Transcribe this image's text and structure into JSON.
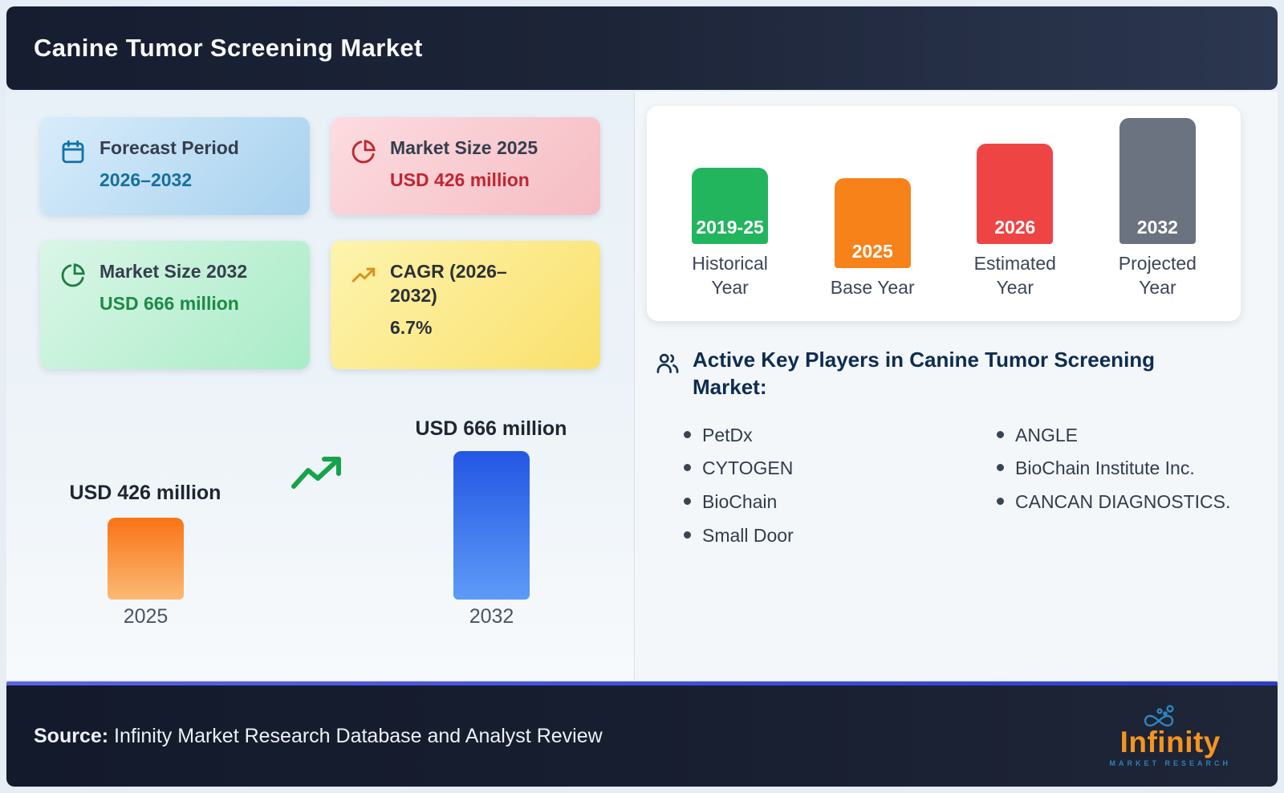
{
  "header": {
    "title": "Canine Tumor Screening Market"
  },
  "cards": [
    {
      "icon": "calendar-icon",
      "title": "Forecast Period",
      "value": "2026–2032"
    },
    {
      "icon": "pie-chart-icon",
      "title": "Market Size 2025",
      "value": "USD 426 million"
    },
    {
      "icon": "pie-chart-icon",
      "title": "Market Size 2032",
      "value": "USD 666 million"
    },
    {
      "icon": "trend-up-icon",
      "title": "CAGR (2026–2032)",
      "value": "6.7%"
    }
  ],
  "chart_data": [
    {
      "type": "bar",
      "title": "Canine Tumor Screening Market size growth",
      "categories": [
        "2025",
        "2032"
      ],
      "values": [
        426,
        666
      ],
      "unit": "USD million",
      "data_labels": [
        "USD 426 million",
        "USD 666 million"
      ],
      "bar_colors": [
        "#f97316",
        "#2563eb"
      ],
      "annotations": [
        "growth-arrow-icon between bars"
      ],
      "grid": false,
      "legend": false
    },
    {
      "type": "bar",
      "title": "Study period timeline",
      "categories": [
        "Historical Year",
        "Base Year",
        "Estimated Year",
        "Projected Year"
      ],
      "bar_labels": [
        "2019-25",
        "2025",
        "2026",
        "2032"
      ],
      "values": [
        1,
        2,
        3,
        4
      ],
      "values_note": "relative heights only, no numeric axis shown",
      "bar_colors": [
        "#22b55e",
        "#f8821a",
        "#ee4444",
        "#6b7280"
      ],
      "grid": false,
      "legend": false
    }
  ],
  "key_players": {
    "heading": "Active Key Players in Canine Tumor Screening Market:",
    "column_left": [
      "PetDx",
      "CYTOGEN",
      "BioChain",
      "Small Door"
    ],
    "column_right": [
      "ANGLE",
      "BioChain Institute Inc.",
      "CANCAN DIAGNOSTICS."
    ]
  },
  "footer": {
    "source_label": "Source:",
    "source_text": " Infinity Market Research Database and Analyst Review",
    "logo": {
      "name": "Infinity",
      "subtitle": "MARKET RESEARCH",
      "mark": "infinity-icon"
    }
  },
  "colors": {
    "header_bg": "#1a2234",
    "footer_bg": "#151b2d",
    "footer_accent": "#2c3ecf",
    "card_blue_value": "#15709f",
    "card_red_value": "#c02630",
    "card_green_value": "#1d8a47",
    "growth_bar_orange": "#f97316",
    "growth_bar_blue": "#2563eb",
    "timeline_green": "#22b55e",
    "timeline_orange": "#f8821a",
    "timeline_red": "#ee4444",
    "timeline_gray": "#6b7280",
    "logo_orange": "#f5941f",
    "logo_blue": "#2f7fb8"
  }
}
